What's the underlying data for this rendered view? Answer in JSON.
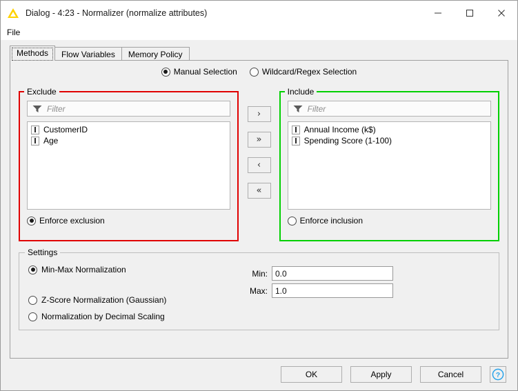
{
  "window": {
    "title": "Dialog - 4:23 - Normalizer (normalize attributes)",
    "icon": "knime-triangle-icon",
    "controls": {
      "minimize": "minimize-icon",
      "maximize": "maximize-icon",
      "close": "close-icon"
    }
  },
  "menubar": {
    "items": [
      {
        "label": "File"
      }
    ]
  },
  "tabs": [
    {
      "label": "Methods",
      "selected": true
    },
    {
      "label": "Flow Variables",
      "selected": false
    },
    {
      "label": "Memory Policy",
      "selected": false
    }
  ],
  "selection_mode": {
    "manual": {
      "label": "Manual Selection",
      "selected": true
    },
    "wildcard": {
      "label": "Wildcard/Regex Selection",
      "selected": false
    }
  },
  "exclude": {
    "legend": "Exclude",
    "border_color": "#e00000",
    "filter_placeholder": "Filter",
    "filter_value": "",
    "items": [
      {
        "label": "CustomerID",
        "type_icon": "integer-column-icon"
      },
      {
        "label": "Age",
        "type_icon": "integer-column-icon"
      }
    ],
    "enforce": {
      "label": "Enforce exclusion",
      "selected": true
    }
  },
  "include": {
    "legend": "Include",
    "border_color": "#00d000",
    "filter_placeholder": "Filter",
    "filter_value": "",
    "items": [
      {
        "label": "Annual Income (k$)",
        "type_icon": "integer-column-icon"
      },
      {
        "label": "Spending Score (1-100)",
        "type_icon": "integer-column-icon"
      }
    ],
    "enforce": {
      "label": "Enforce inclusion",
      "selected": false
    }
  },
  "transfer_buttons": [
    {
      "label": "›",
      "name": "move-right-button"
    },
    {
      "label": "»",
      "name": "move-all-right-button"
    },
    {
      "label": "‹",
      "name": "move-left-button"
    },
    {
      "label": "«",
      "name": "move-all-left-button"
    }
  ],
  "settings": {
    "legend": "Settings",
    "options": [
      {
        "label": "Min-Max Normalization",
        "selected": true
      },
      {
        "label": "Z-Score Normalization (Gaussian)",
        "selected": false
      },
      {
        "label": "Normalization by Decimal Scaling",
        "selected": false
      }
    ],
    "min": {
      "label": "Min:",
      "value": "0.0"
    },
    "max": {
      "label": "Max:",
      "value": "1.0"
    }
  },
  "footer": {
    "ok": "OK",
    "apply": "Apply",
    "cancel": "Cancel",
    "help": "help-icon"
  }
}
